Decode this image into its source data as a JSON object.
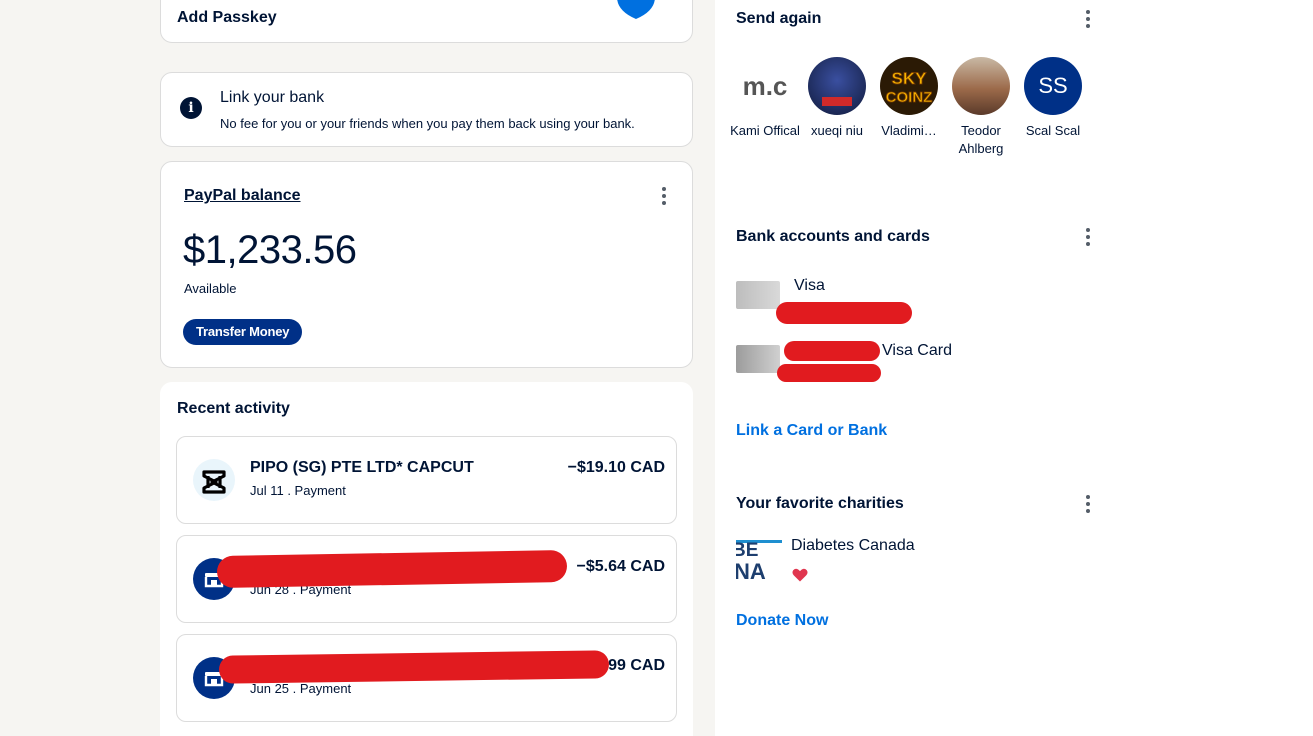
{
  "passkey": {
    "title": "Add Passkey"
  },
  "link_bank": {
    "info_icon": "info-icon",
    "title": "Link your bank",
    "subtitle": "No fee for you or your friends when you pay them back using your bank."
  },
  "balance": {
    "label": "PayPal balance",
    "amount": "$1,233.56",
    "available": "Available",
    "transfer_label": "Transfer Money"
  },
  "recent": {
    "title": "Recent activity",
    "transactions": [
      {
        "name": "PIPO (SG) PTE LTD* CAPCUT",
        "meta": "Jul 11 . Payment",
        "amount": "−$19.10 CAD",
        "icon": "capcut-icon"
      },
      {
        "name": "",
        "meta": "Jun 28 . Payment",
        "amount": "−$5.64 CAD",
        "icon": "store-icon"
      },
      {
        "name": "",
        "meta": "Jun 25 . Payment",
        "amount": "99 CAD",
        "icon": "store-icon"
      }
    ]
  },
  "send_again": {
    "title": "Send again",
    "contacts": [
      {
        "name": "Kami Offical",
        "avatar": "image"
      },
      {
        "name": "xueqi niu",
        "avatar": "image"
      },
      {
        "name": "Vladimi…",
        "avatar": "image"
      },
      {
        "name": "Teodor Ahlberg",
        "avatar": "image"
      },
      {
        "name": "Scal Scal",
        "avatar": "initials",
        "initials": "SS"
      }
    ]
  },
  "banks": {
    "title": "Bank accounts and cards",
    "items": [
      {
        "name": "Visa"
      },
      {
        "name": "Visa Card"
      }
    ],
    "link_label": "Link a Card or Bank"
  },
  "charities": {
    "title": "Your favorite charities",
    "items": [
      {
        "name": "Diabetes Canada"
      }
    ],
    "donate_label": "Donate Now"
  },
  "colors": {
    "navy": "#003087",
    "link_blue": "#0070e0",
    "redaction": "#e11b1f",
    "heart": "#e0364f"
  }
}
